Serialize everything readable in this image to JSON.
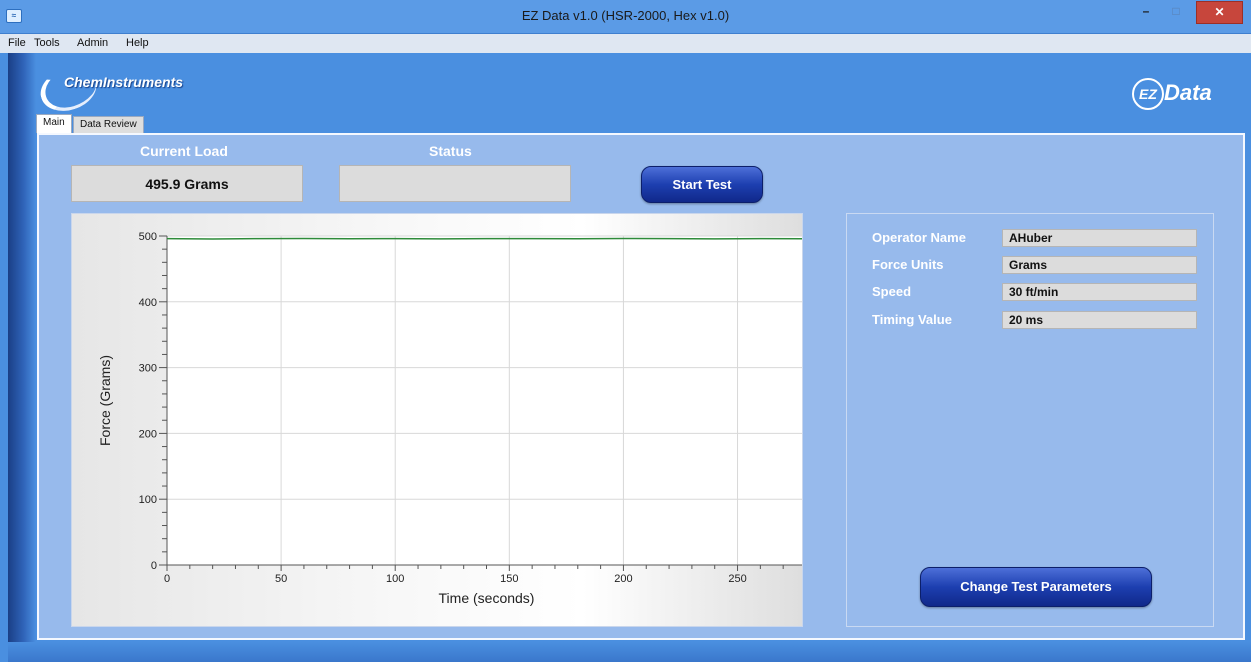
{
  "window": {
    "title": "EZ Data v1.0 (HSR-2000, Hex v1.0)",
    "minimize_glyph": "–",
    "maximize_glyph": "□",
    "close_glyph": "✕",
    "app_icon_glyph": "≈"
  },
  "menu": [
    "File",
    "Tools",
    "Admin",
    "Help"
  ],
  "logos": {
    "left": "ChemInstruments",
    "right_mark": "EZ",
    "right_word": "Data"
  },
  "tabs": [
    "Main",
    "Data Review"
  ],
  "current_load": {
    "label": "Current Load",
    "value": "495.9 Grams"
  },
  "status": {
    "label": "Status",
    "value": ""
  },
  "start_button": "Start Test",
  "parameters": [
    {
      "label": "Operator Name",
      "value": "AHuber"
    },
    {
      "label": "Force Units",
      "value": "Grams"
    },
    {
      "label": "Speed",
      "value": "30 ft/min"
    },
    {
      "label": "Timing Value",
      "value": "20 ms"
    }
  ],
  "change_button": "Change Test Parameters",
  "colors": {
    "app_background": "#4a8fe0",
    "panel": "#97baec",
    "series": "#2e8b3a",
    "button": "#1d3fb0"
  },
  "chart_data": {
    "type": "line",
    "title": "",
    "xlabel": "Time (seconds)",
    "ylabel": "Force (Grams)",
    "xlim": [
      0,
      280
    ],
    "ylim": [
      0,
      500
    ],
    "x_ticks": [
      0,
      50,
      100,
      150,
      200,
      250
    ],
    "y_ticks": [
      0,
      100,
      200,
      300,
      400,
      500
    ],
    "x_minor_step": 10,
    "y_minor_step": 20,
    "grid": true,
    "series": [
      {
        "name": "",
        "x": [
          0,
          20,
          40,
          60,
          80,
          100,
          120,
          140,
          160,
          180,
          200,
          220,
          240,
          260,
          280
        ],
        "y": [
          496,
          495.5,
          496,
          496.2,
          495.8,
          496,
          495.7,
          496.1,
          496,
          495.8,
          496.2,
          496,
          495.6,
          496,
          495.9
        ]
      }
    ]
  }
}
